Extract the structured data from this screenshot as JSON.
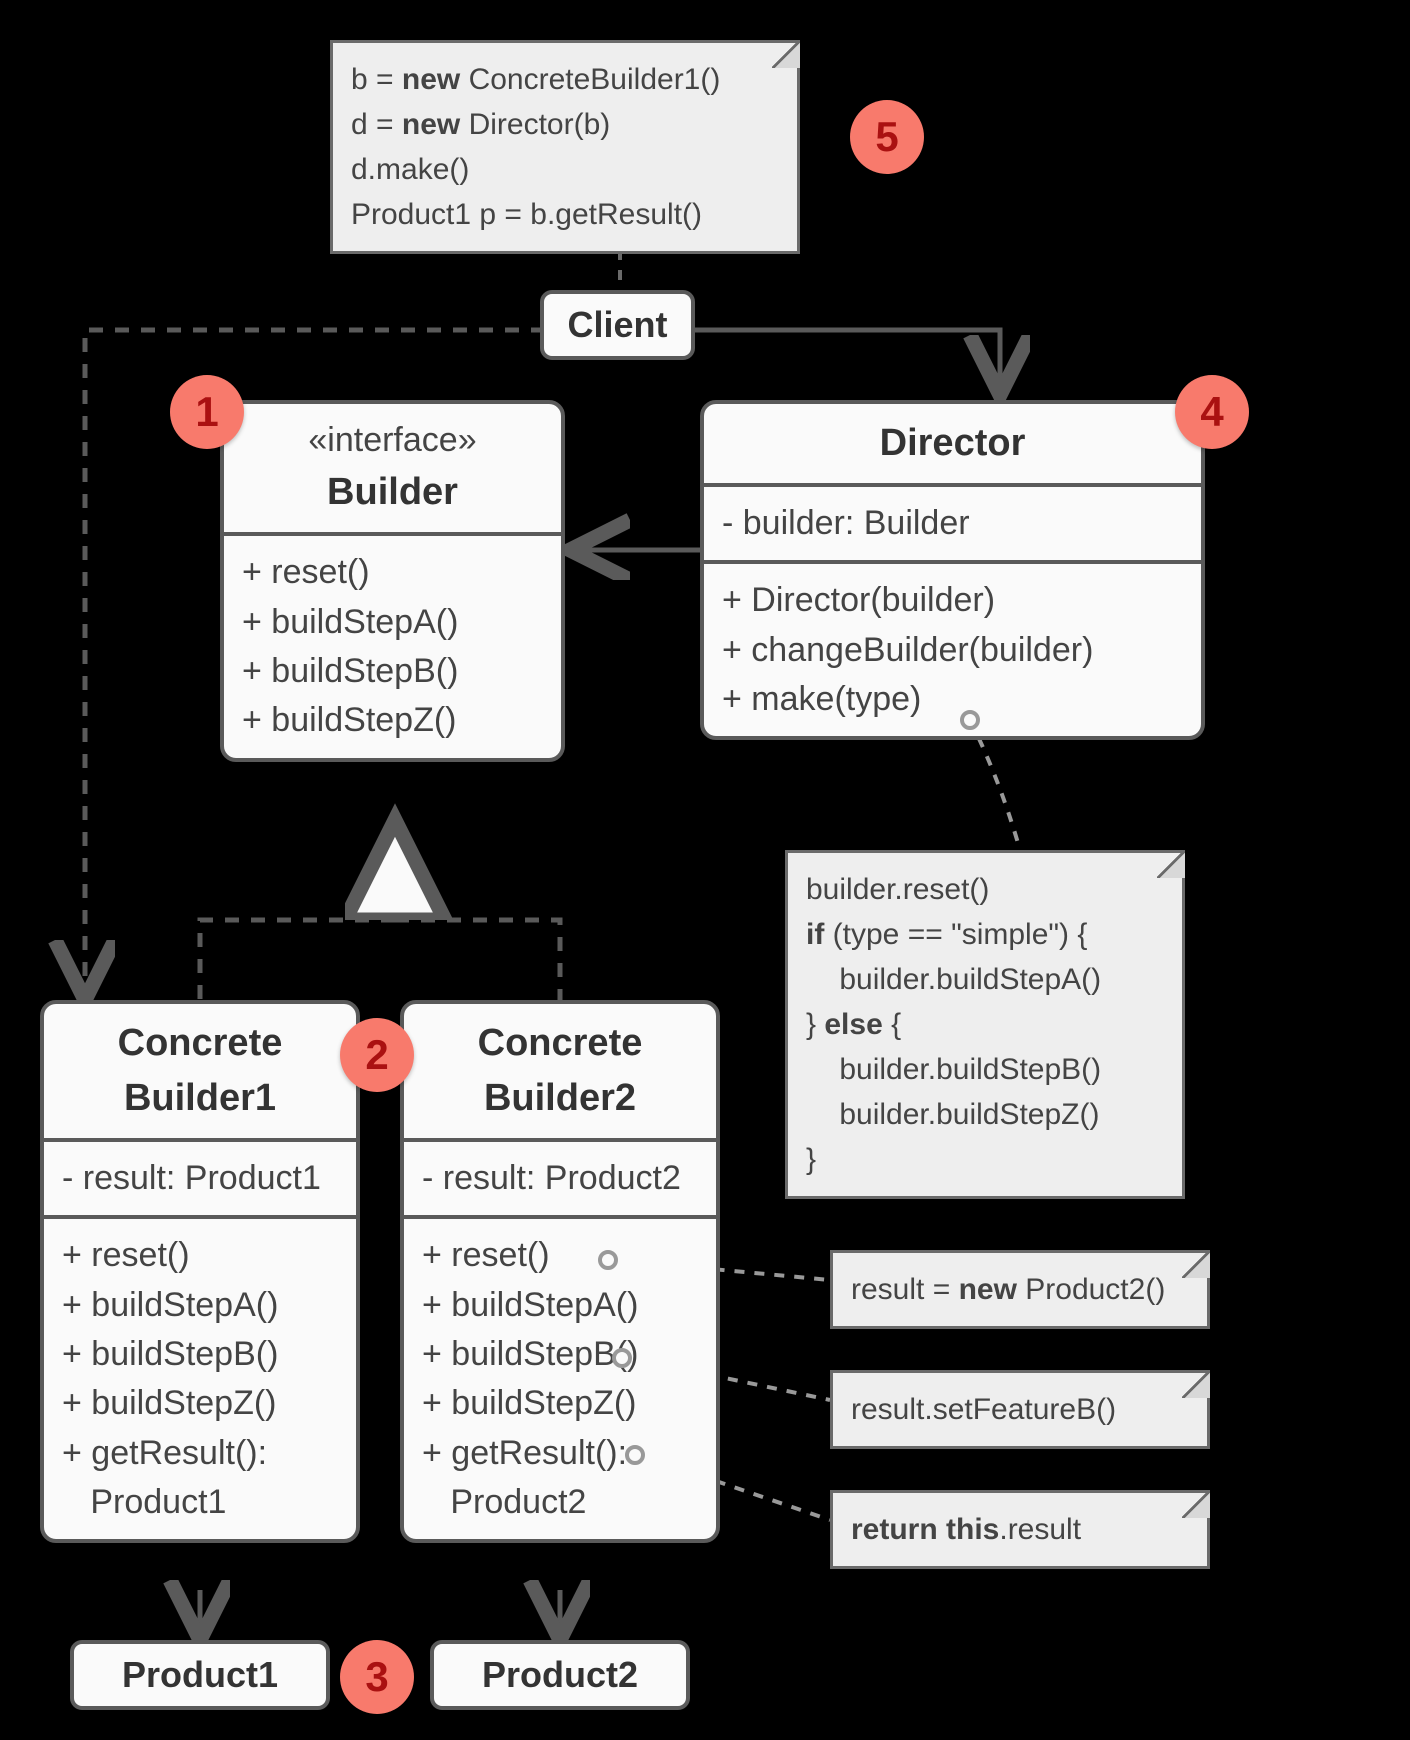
{
  "note_client": {
    "line1a": "b = ",
    "line1kw": "new",
    "line1b": " ConcreteBuilder1()",
    "line2a": "d = ",
    "line2kw": "new",
    "line2b": " Director(b)",
    "line3": "d.make()",
    "line4": "Product1 p = b.getResult()"
  },
  "client_label": "Client",
  "builder": {
    "stereotype": "«interface»",
    "name": "Builder",
    "methods": [
      "+ reset()",
      "+ buildStepA()",
      "+ buildStepB()",
      "+ buildStepZ()"
    ]
  },
  "director": {
    "name": "Director",
    "attrs": [
      "- builder: Builder"
    ],
    "methods": [
      "+ Director(builder)",
      "+ changeBuilder(builder)",
      "+ make(type)"
    ]
  },
  "cb1": {
    "name1": "Concrete",
    "name2": "Builder1",
    "attrs": [
      "- result: Product1"
    ],
    "methods": [
      "+ reset()",
      "+ buildStepA()",
      "+ buildStepB()",
      "+ buildStepZ()",
      "+ getResult():",
      "   Product1"
    ]
  },
  "cb2": {
    "name1": "Concrete",
    "name2": "Builder2",
    "attrs": [
      "- result: Product2"
    ],
    "methods": [
      "+ reset()",
      "+ buildStepA()",
      "+ buildStepB()",
      "+ buildStepZ()",
      "+ getResult():",
      "   Product2"
    ]
  },
  "product1": "Product1",
  "product2": "Product2",
  "note_make": {
    "l1": "builder.reset()",
    "l2a": "if",
    "l2b": " (type == \"simple\") {",
    "l3": "    builder.buildStepA()",
    "l4a": "} ",
    "l4b": "else",
    "l4c": " {",
    "l5": "    builder.buildStepB()",
    "l6": "    builder.buildStepZ()",
    "l7": "}"
  },
  "note_reset_a": "result = ",
  "note_reset_kw": "new",
  "note_reset_b": " Product2()",
  "note_stepb": "result.setFeatureB()",
  "note_getresult_a": "return this",
  "note_getresult_b": ".result",
  "badges": {
    "b1": "1",
    "b2": "2",
    "b3": "3",
    "b4": "4",
    "b5": "5"
  }
}
